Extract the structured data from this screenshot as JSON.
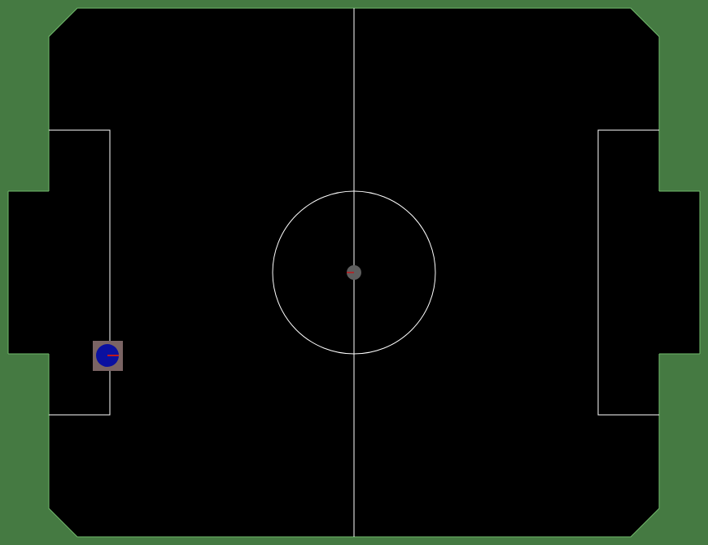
{
  "colors": {
    "wall": "#457a42",
    "wall_edge": "#70b86a",
    "pitch": "#000000",
    "line": "#ffffff",
    "ball": "#5e5e5e",
    "robot_body": "#0a10a0",
    "robot_base": "#7a6464",
    "heading": "#c0181c"
  },
  "field": {
    "pitch": "black",
    "walls": "green",
    "corners": "chamfered",
    "goals": [
      "left",
      "right"
    ]
  },
  "objects": {
    "ball": {
      "name": "ball",
      "heading": "west"
    },
    "robot": {
      "name": "robot",
      "team": "blue",
      "heading": "east"
    }
  }
}
